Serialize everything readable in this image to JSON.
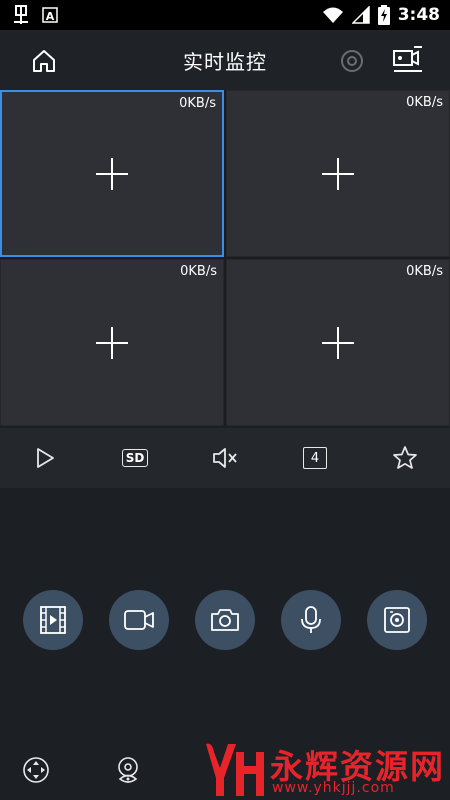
{
  "status_bar": {
    "time": "3:48",
    "left_icons": [
      "notification-app-icon",
      "font-a-icon"
    ],
    "right_icons": [
      "wifi-icon",
      "signal-icon",
      "battery-charging-icon"
    ]
  },
  "header": {
    "title": "实时监控",
    "home_icon": "home-icon",
    "settings_icon": "settings-icon",
    "devices_icon": "device-list-icon"
  },
  "grid": {
    "cells": [
      {
        "rate": "0KB/s",
        "selected": true
      },
      {
        "rate": "0KB/s",
        "selected": false
      },
      {
        "rate": "0KB/s",
        "selected": false
      },
      {
        "rate": "0KB/s",
        "selected": false
      }
    ]
  },
  "controls": {
    "quality_label": "SD",
    "split_label": "4",
    "icons": [
      "play-icon",
      "sd-quality-icon",
      "mute-icon",
      "split-4-icon",
      "favorite-star-icon"
    ]
  },
  "actions": {
    "icons": [
      "video-playback-icon",
      "record-icon",
      "snapshot-camera-icon",
      "microphone-icon",
      "ptz-icon"
    ]
  },
  "bottom": {
    "icons": [
      "direction-icon",
      "preset-eye-icon"
    ]
  },
  "watermark": {
    "text": "永辉资源网",
    "url": "www.yhkjjj.com"
  },
  "colors": {
    "background": "#1c1f24",
    "cell": "#2e3035",
    "selected_border": "#3a8ee6",
    "action_circle": "#3d4f63",
    "watermark": "#e8242b"
  }
}
